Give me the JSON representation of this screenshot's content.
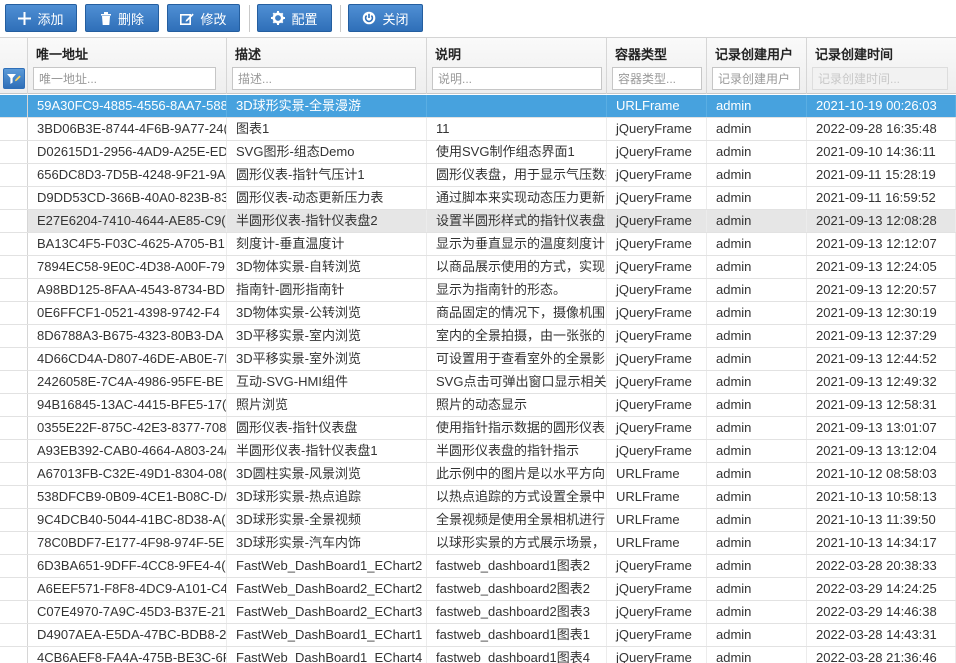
{
  "toolbar": {
    "add_label": "添加",
    "delete_label": "删除",
    "edit_label": "修改",
    "config_label": "配置",
    "close_label": "关闭",
    "accent": "#2f6fb8"
  },
  "columns": [
    {
      "title": "唯一地址",
      "placeholder": "唯一地址..."
    },
    {
      "title": "描述",
      "placeholder": "描述..."
    },
    {
      "title": "说明",
      "placeholder": "说明..."
    },
    {
      "title": "容器类型",
      "placeholder": "容器类型..."
    },
    {
      "title": "记录创建用户",
      "placeholder": "记录创建用户"
    },
    {
      "title": "记录创建时间",
      "placeholder": "记录创建时间..."
    }
  ],
  "selection_color": "#47a2de",
  "rows": [
    [
      "59A30FC9-4885-4556-8AA7-588",
      "3D球形实景-全景漫游",
      "",
      "URLFrame",
      "admin",
      "2021-10-19 00:26:03"
    ],
    [
      "3BD06B3E-8744-4F6B-9A77-24(",
      "图表1",
      "11",
      "jQueryFrame",
      "admin",
      "2022-09-28 16:35:48"
    ],
    [
      "D02615D1-2956-4AD9-A25E-ED",
      "SVG图形-组态Demo",
      "使用SVG制作组态界面1",
      "jQueryFrame",
      "admin",
      "2021-09-10 14:36:11"
    ],
    [
      "656DC8D3-7D5B-4248-9F21-9A",
      "圆形仪表-指针气压计1",
      "圆形仪表盘，用于显示气压数据",
      "jQueryFrame",
      "admin",
      "2021-09-11 15:28:19"
    ],
    [
      "D9DD53CD-366B-40A0-823B-83",
      "圆形仪表-动态更新压力表",
      "通过脚本来实现动态压力更新",
      "jQueryFrame",
      "admin",
      "2021-09-11 16:59:52"
    ],
    [
      "E27E6204-7410-4644-AE85-C9(",
      "半圆形仪表-指针仪表盘2",
      "设置半圆形样式的指针仪表盘",
      "jQueryFrame",
      "admin",
      "2021-09-13 12:08:28"
    ],
    [
      "BA13C4F5-F03C-4625-A705-B1",
      "刻度计-垂直温度计",
      "显示为垂直显示的温度刻度计",
      "jQueryFrame",
      "admin",
      "2021-09-13 12:12:07"
    ],
    [
      "7894EC58-9E0C-4D38-A00F-79",
      "3D物体实景-自转浏览",
      "以商品展示使用的方式，实现",
      "jQueryFrame",
      "admin",
      "2021-09-13 12:24:05"
    ],
    [
      "A98BD125-8FAA-4543-8734-BD",
      "指南针-圆形指南针",
      "显示为指南针的形态。",
      "jQueryFrame",
      "admin",
      "2021-09-13 12:20:57"
    ],
    [
      "0E6FFCF1-0521-4398-9742-F4",
      "3D物体实景-公转浏览",
      "商品固定的情况下，摄像机围",
      "jQueryFrame",
      "admin",
      "2021-09-13 12:30:19"
    ],
    [
      "8D6788A3-B675-4323-80B3-DA",
      "3D平移实景-室内浏览",
      "室内的全景拍摄，由一张张的",
      "jQueryFrame",
      "admin",
      "2021-09-13 12:37:29"
    ],
    [
      "4D66CD4A-D807-46DE-AB0E-7I",
      "3D平移实景-室外浏览",
      "可设置用于查看室外的全景影",
      "jQueryFrame",
      "admin",
      "2021-09-13 12:44:52"
    ],
    [
      "2426058E-7C4A-4986-95FE-BE",
      "互动-SVG-HMI组件",
      "SVG点击可弹出窗口显示相关",
      "jQueryFrame",
      "admin",
      "2021-09-13 12:49:32"
    ],
    [
      "94B16845-13AC-4415-BFE5-17(",
      "照片浏览",
      "照片的动态显示",
      "jQueryFrame",
      "admin",
      "2021-09-13 12:58:31"
    ],
    [
      "0355E22F-875C-42E3-8377-708",
      "圆形仪表-指针仪表盘",
      "使用指针指示数据的圆形仪表",
      "jQueryFrame",
      "admin",
      "2021-09-13 13:01:07"
    ],
    [
      "A93EB392-CAB0-4664-A803-24/",
      "半圆形仪表-指针仪表盘1",
      "半圆形仪表盘的指针指示",
      "jQueryFrame",
      "admin",
      "2021-09-13 13:12:04"
    ],
    [
      "A67013FB-C32E-49D1-8304-08(",
      "3D圆柱实景-风景浏览",
      "此示例中的图片是以水平方向",
      "URLFrame",
      "admin",
      "2021-10-12 08:58:03"
    ],
    [
      "538DFCB9-0B09-4CE1-B08C-D/",
      "3D球形实景-热点追踪",
      "以热点追踪的方式设置全景中",
      "URLFrame",
      "admin",
      "2021-10-13 10:58:13"
    ],
    [
      "9C4DCB40-5044-41BC-8D38-A(",
      "3D球形实景-全景视频",
      "全景视频是使用全景相机进行",
      "URLFrame",
      "admin",
      "2021-10-13 11:39:50"
    ],
    [
      "78C0BDF7-E177-4F98-974F-5E",
      "3D球形实景-汽车内饰",
      "以球形实景的方式展示场景，",
      "URLFrame",
      "admin",
      "2021-10-13 14:34:17"
    ],
    [
      "6D3BA651-9DFF-4CC8-9FE4-4(",
      "FastWeb_DashBoard1_EChart2",
      "fastweb_dashboard1图表2",
      "jQueryFrame",
      "admin",
      "2022-03-28 20:38:33"
    ],
    [
      "A6EEF571-F8F8-4DC9-A101-C4",
      "FastWeb_DashBoard2_EChart2",
      "fastweb_dashboard2图表2",
      "jQueryFrame",
      "admin",
      "2022-03-29 14:24:25"
    ],
    [
      "C07E4970-7A9C-45D3-B37E-21",
      "FastWeb_DashBoard2_EChart3",
      "fastweb_dashboard2图表3",
      "jQueryFrame",
      "admin",
      "2022-03-29 14:46:38"
    ],
    [
      "D4907AEA-E5DA-47BC-BDB8-2",
      "FastWeb_DashBoard1_EChart1",
      "fastweb_dashboard1图表1",
      "jQueryFrame",
      "admin",
      "2022-03-28 14:43:31"
    ],
    [
      "4CB6AEF8-FA4A-475B-BE3C-6F",
      "FastWeb_DashBoard1_EChart4",
      "fastweb_dashboard1图表4",
      "jQueryFrame",
      "admin",
      "2022-03-28 21:36:46"
    ]
  ]
}
